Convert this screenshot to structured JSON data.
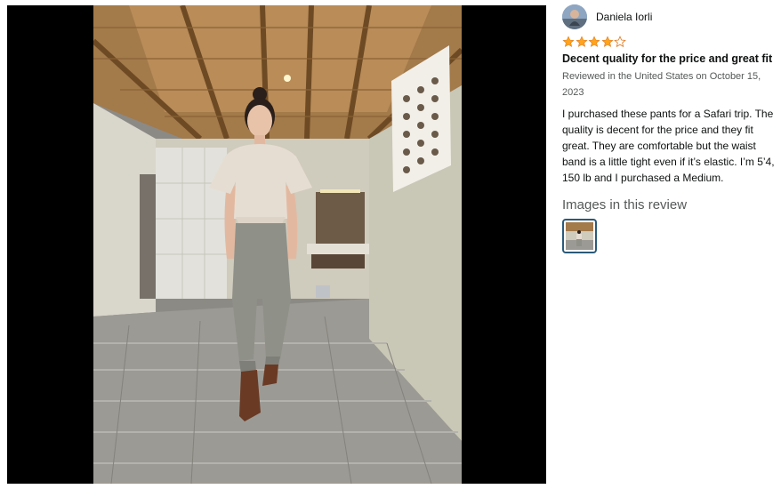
{
  "review": {
    "reviewer_name": "Daniela Iorli",
    "rating": 4,
    "rating_max": 5,
    "title": "Decent quality for the price and great fit",
    "meta": "Reviewed in the United States on October 15, 2023",
    "body": "I purchased these pants for a Safari trip. The quality is decent for the price and they fit great. They are comfortable but the waist band is a little tight even if it’s elastic. I’m 5’4, 150 lb and I purchased a Medium."
  },
  "images_section": {
    "heading": "Images in this review"
  },
  "colors": {
    "star": "#ffa41c",
    "viewer_bg": "#000000",
    "thumb_border": "#2a5a7a"
  },
  "icons": [
    "star-filled-icon",
    "star-empty-icon"
  ]
}
